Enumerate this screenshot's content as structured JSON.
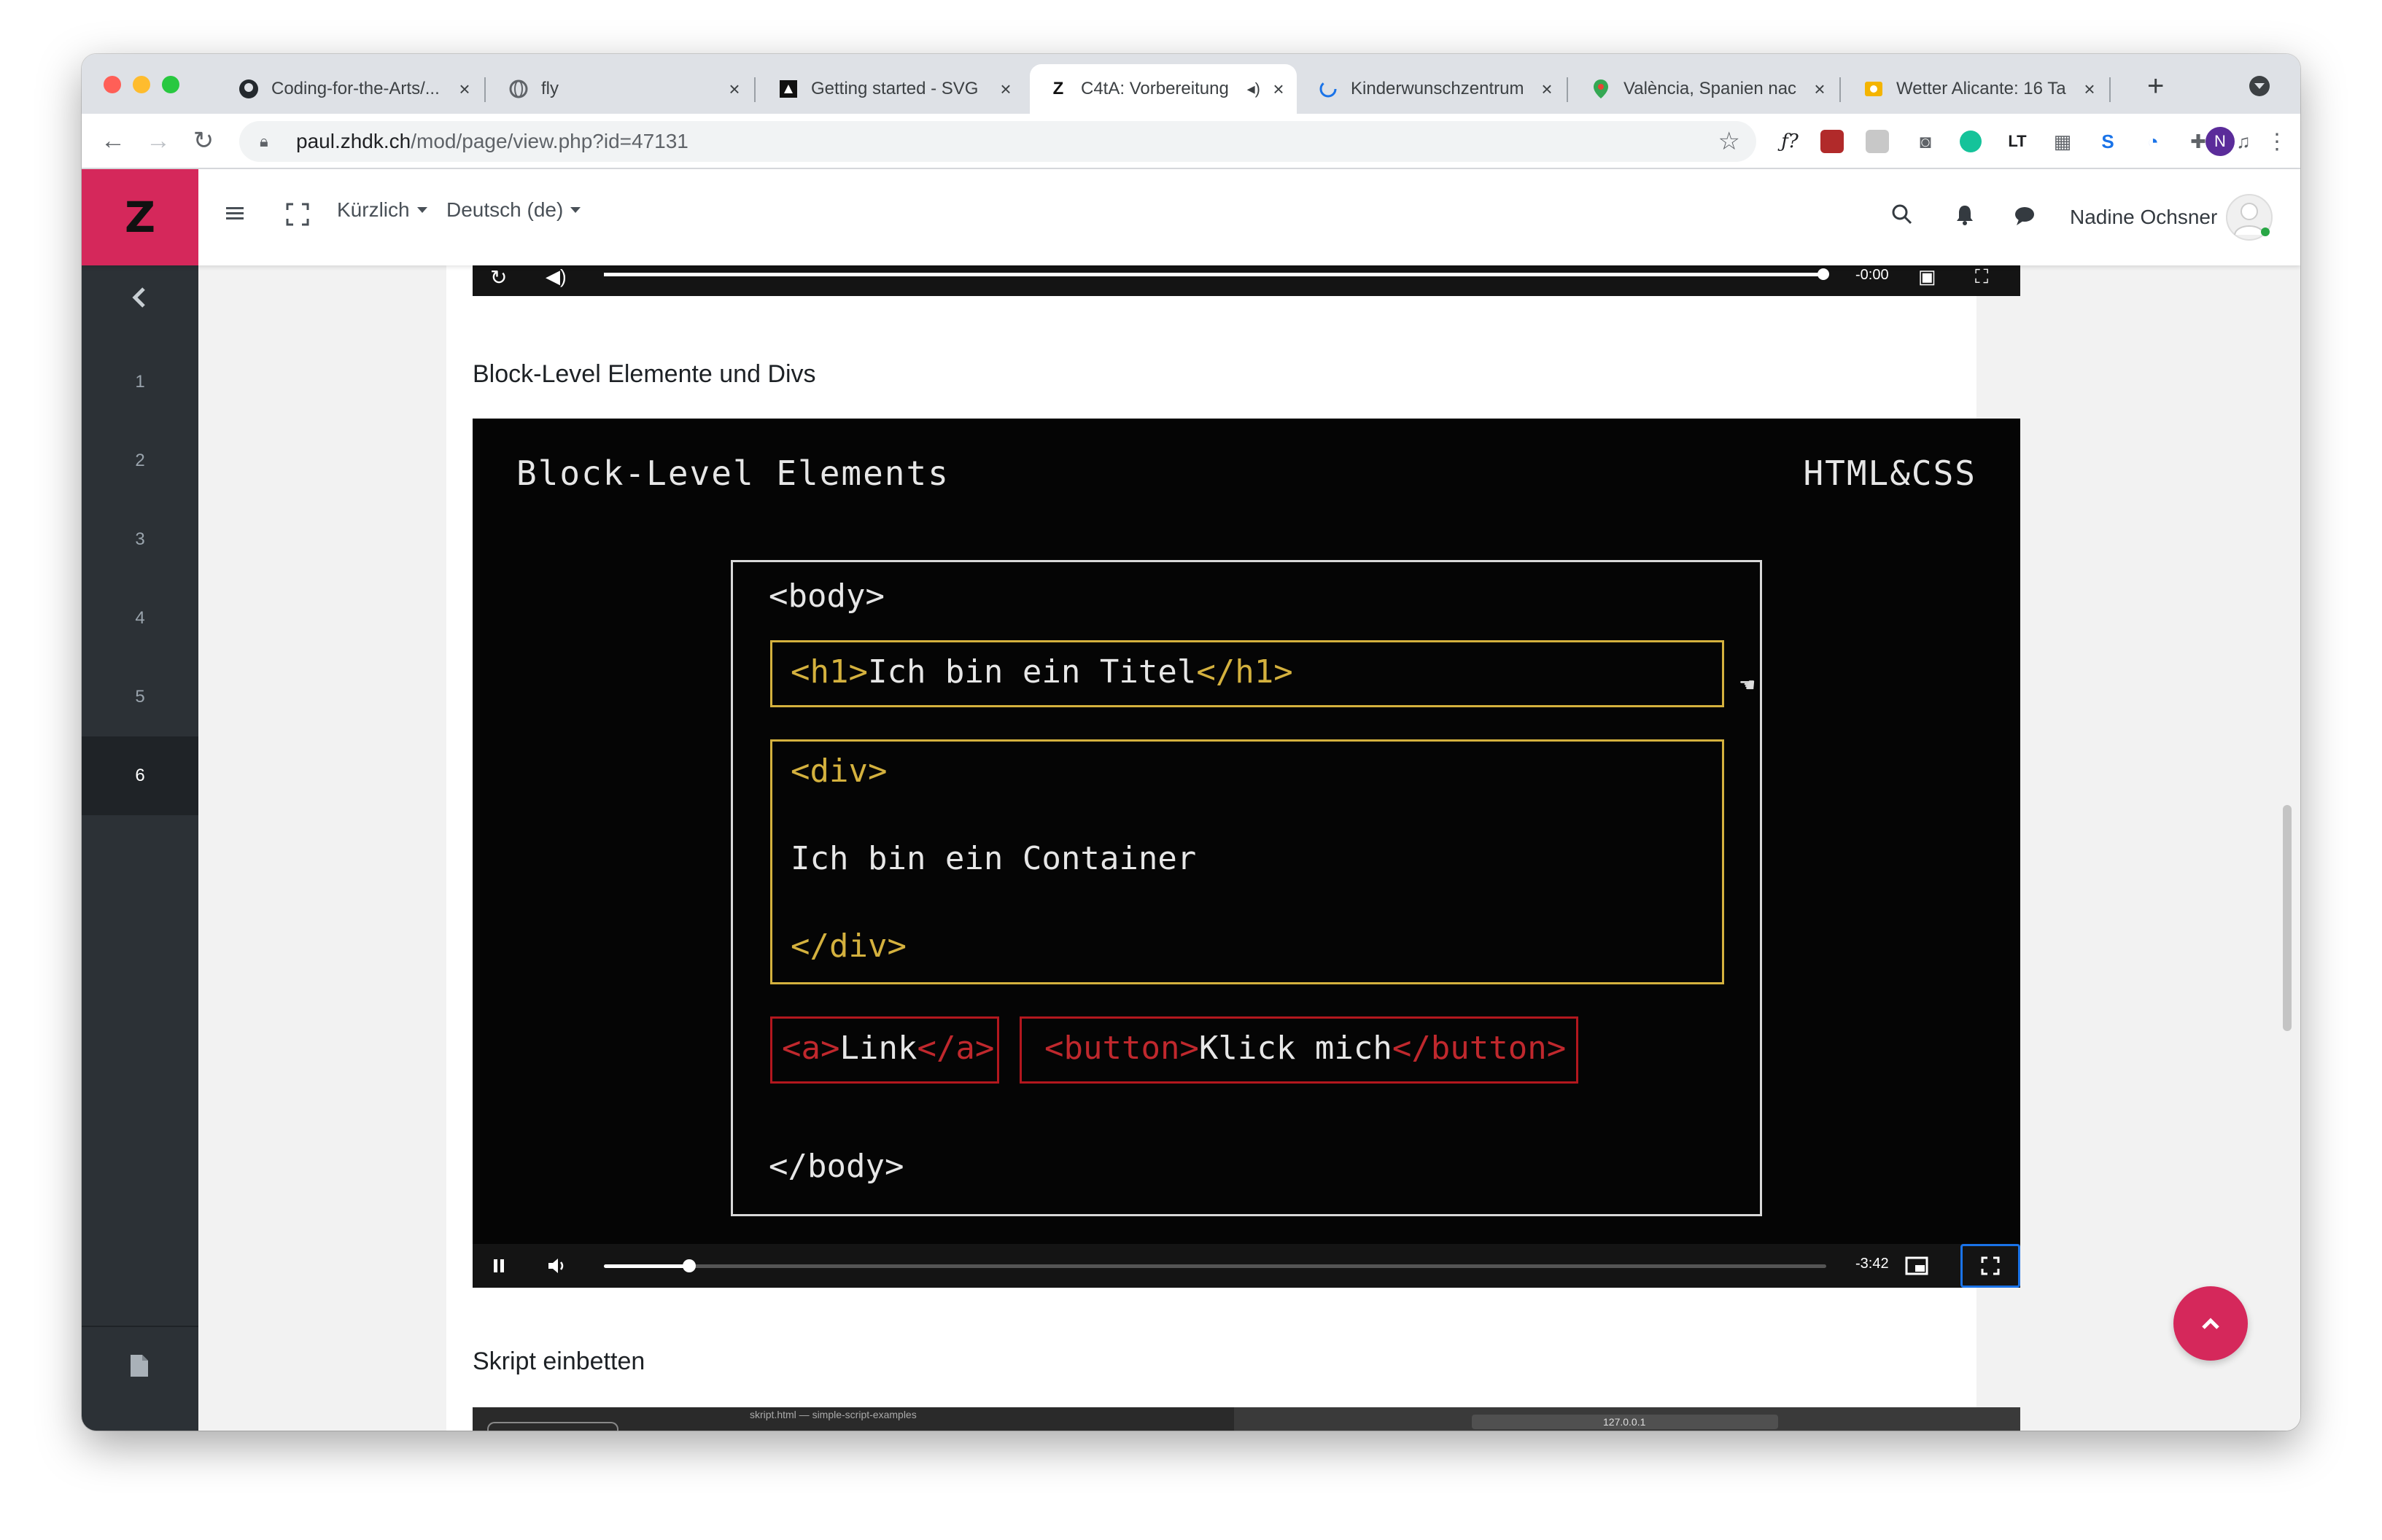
{
  "browser": {
    "tabs": [
      {
        "icon": "github-icon",
        "title": "Coding-for-the-Arts/...",
        "active": false
      },
      {
        "icon": "globe-icon",
        "title": "fly",
        "active": false
      },
      {
        "icon": "svg-icon",
        "title": "Getting started - SVG",
        "active": false
      },
      {
        "icon": "zhdk-icon",
        "title": "C4tA: Vorbereitung",
        "active": true,
        "audio": true
      },
      {
        "icon": "loading-icon",
        "title": "Kinderwunschzentrum",
        "active": false
      },
      {
        "icon": "maps-pin-icon",
        "title": "València, Spanien nac",
        "active": false
      },
      {
        "icon": "weather-icon",
        "title": "Wetter Alicante: 16 Ta",
        "active": false
      }
    ],
    "new_tab": "+",
    "url_host": "paul.zhdk.ch",
    "url_path": "/mod/page/view.php?id=47131",
    "profile_initial": "N"
  },
  "header": {
    "logo": "Z",
    "recent_label": "Kürzlich",
    "language_label": "Deutsch (de)",
    "user_name": "Nadine Ochsner"
  },
  "sidebar": {
    "items": [
      "1",
      "2",
      "3",
      "4",
      "5",
      "6"
    ],
    "active_item": "6"
  },
  "content": {
    "section1_heading": "Block-Level Elemente und Divs",
    "section2_heading": "Skript einbetten",
    "video_top": {
      "time": "-0:00"
    },
    "video": {
      "slide_title": "Block-Level Elements",
      "slide_tag": "HTML&CSS",
      "body_open": "<body>",
      "h1_open": "<h1>",
      "h1_text": "Ich bin ein Titel",
      "h1_close": "</h1>",
      "div_open": "<div>",
      "div_text": "Ich bin ein Container",
      "div_close": "</div>",
      "a_open": "<a>",
      "a_text": "Link",
      "a_close": "</a>",
      "button_open": "<button>",
      "button_text": "Klick mich",
      "button_close": "</button>",
      "body_close": "</body>",
      "time": "-3:42",
      "progress": 0.07
    },
    "video_bottom": {
      "title": "skript.html — simple-script-examples",
      "address": "127.0.0.1"
    }
  },
  "colors": {
    "brand": "#d5285b",
    "sidebar": "#2c3136",
    "code_yellow": "#d4b13e",
    "code_red": "#c0282d"
  }
}
